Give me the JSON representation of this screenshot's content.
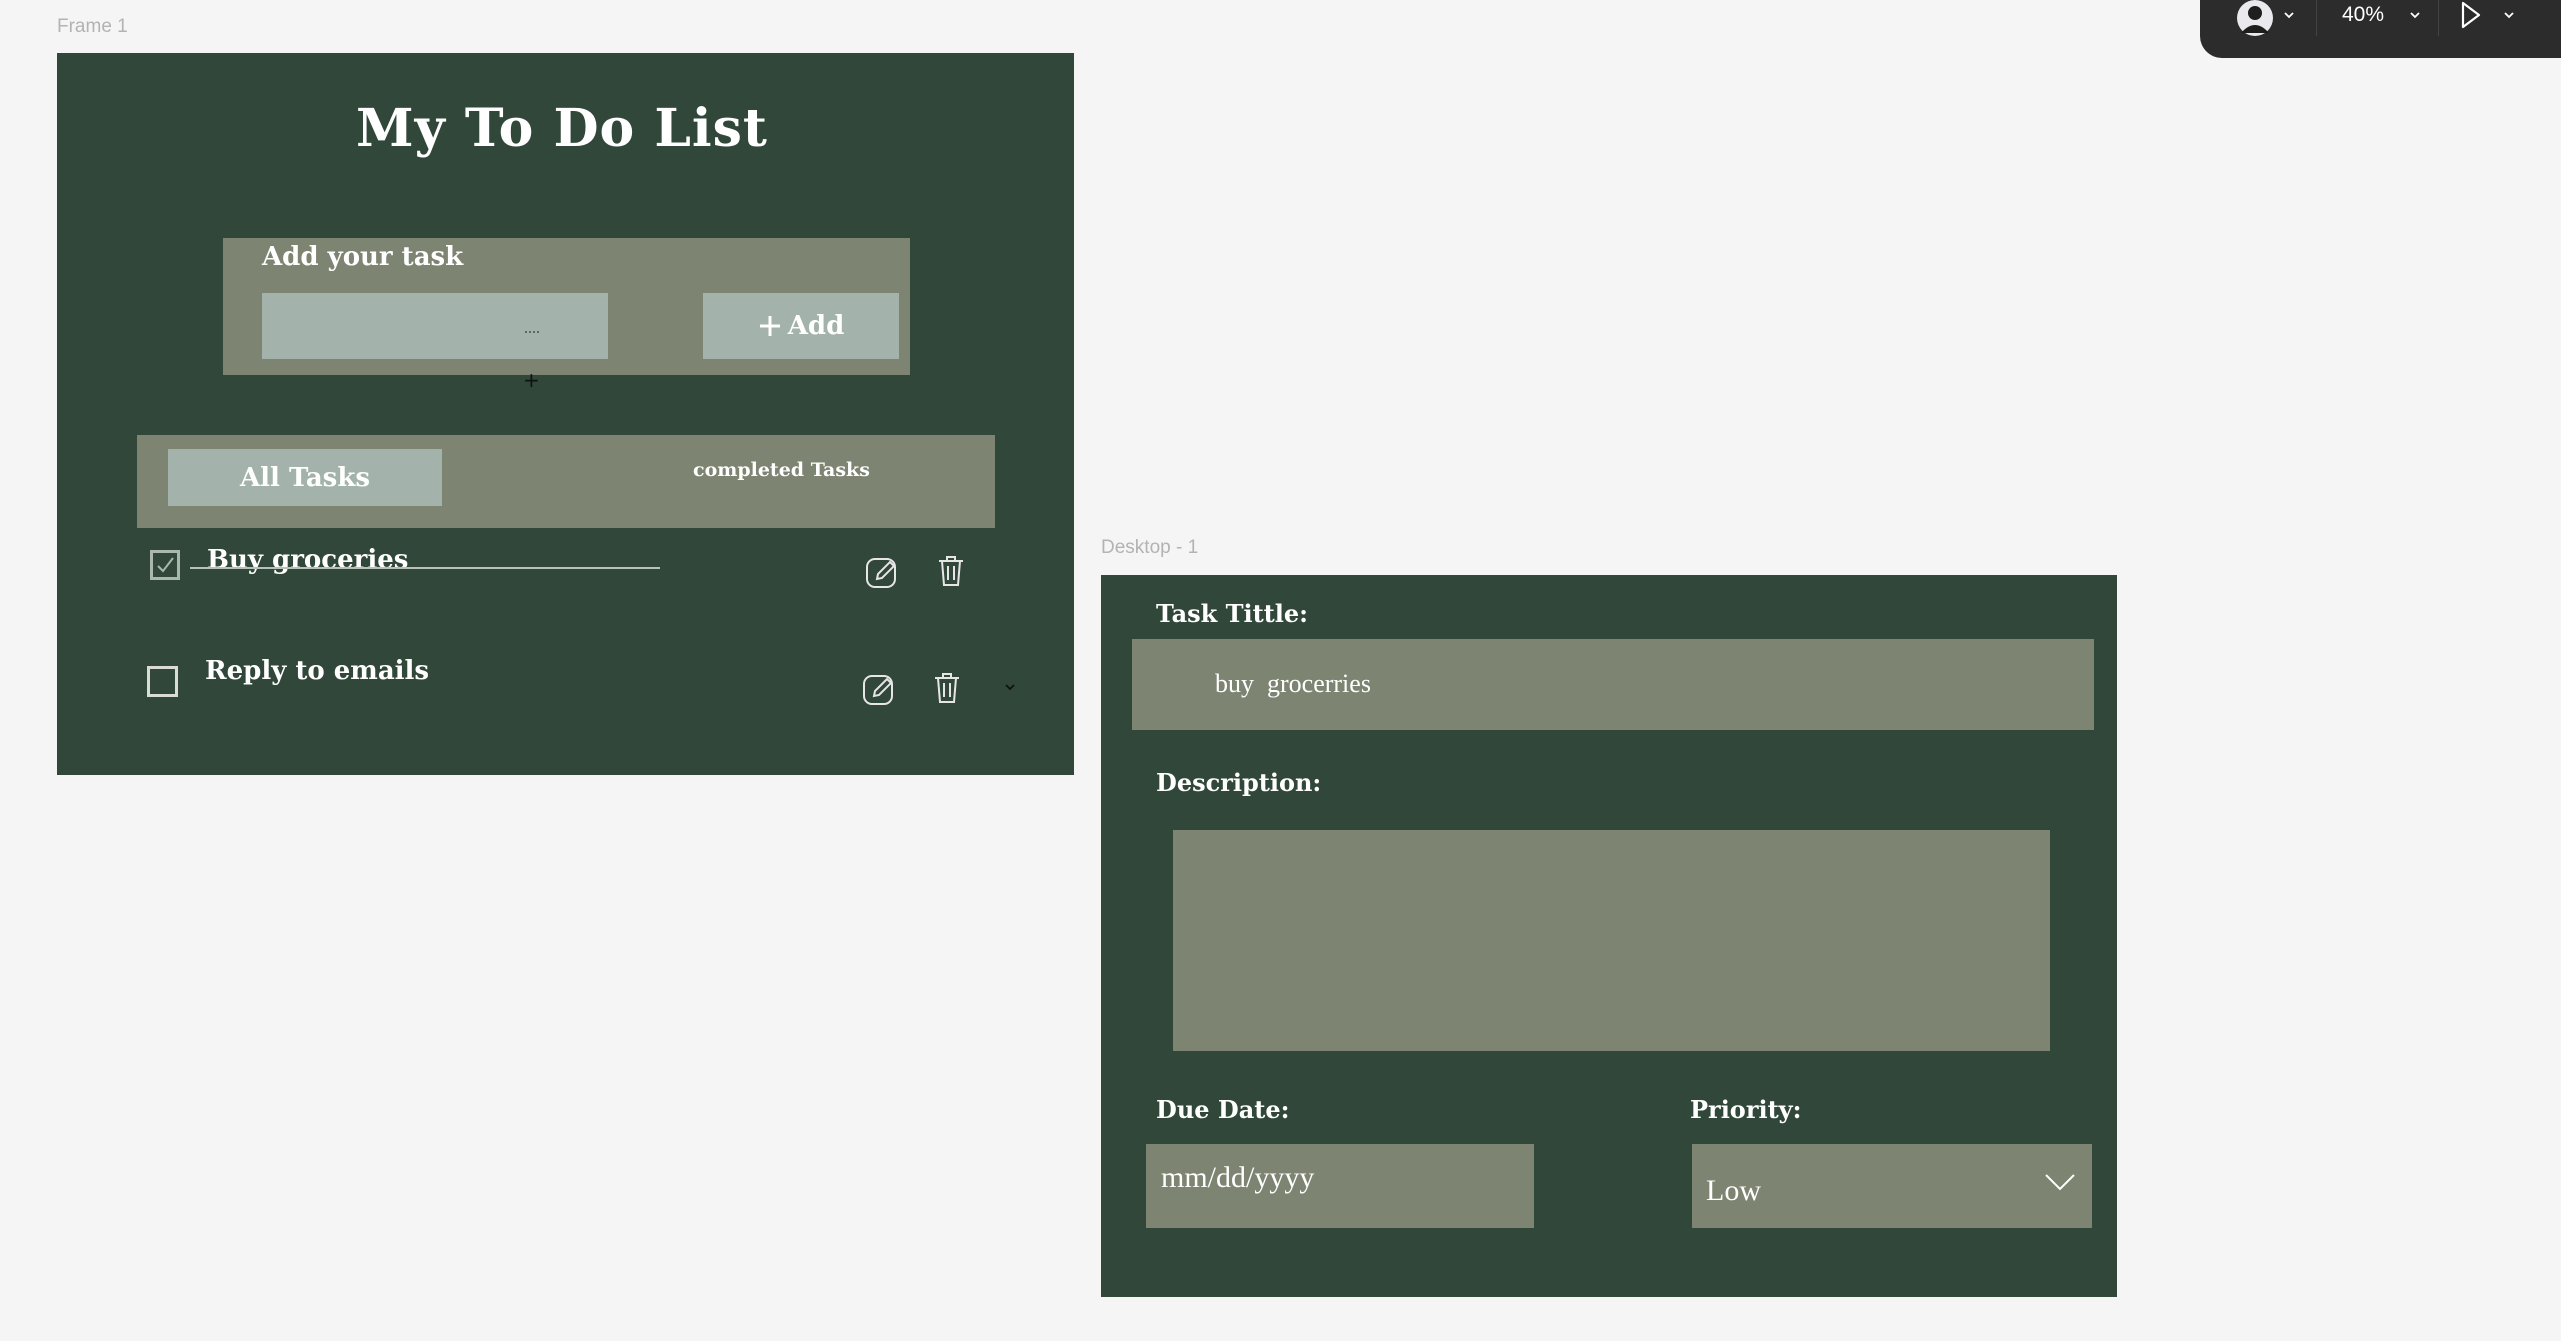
{
  "toolbar": {
    "zoom": "40%",
    "icons": [
      "avatar-icon",
      "chevron-down-icon",
      "play-icon"
    ]
  },
  "frame1": {
    "label": "Frame 1",
    "title": "My To Do List",
    "add_section": {
      "label": "Add your task",
      "input_value": "",
      "add_button": "Add"
    },
    "tabs": [
      {
        "label": "All Tasks",
        "active": true
      },
      {
        "label": "completed Tasks",
        "active": false
      }
    ],
    "tasks": [
      {
        "title": "Buy groceries",
        "completed": true
      },
      {
        "title": "Reply to emails",
        "completed": false
      }
    ]
  },
  "desktop1": {
    "label": "Desktop - 1",
    "task_title_label": "Task Tittle:",
    "task_title_value": "buy  grocerries",
    "description_label": "Description:",
    "description_value": "",
    "due_date_label": "Due Date:",
    "due_date_placeholder": "mm/dd/yyyy",
    "priority_label": "Priority:",
    "priority_value": "Low"
  },
  "colors": {
    "canvas": "#f5f5f5",
    "frame_bg": "#31473a",
    "panel": "#7d8471",
    "input": "#a3b2aa",
    "toolbar": "#2c2c2c"
  }
}
